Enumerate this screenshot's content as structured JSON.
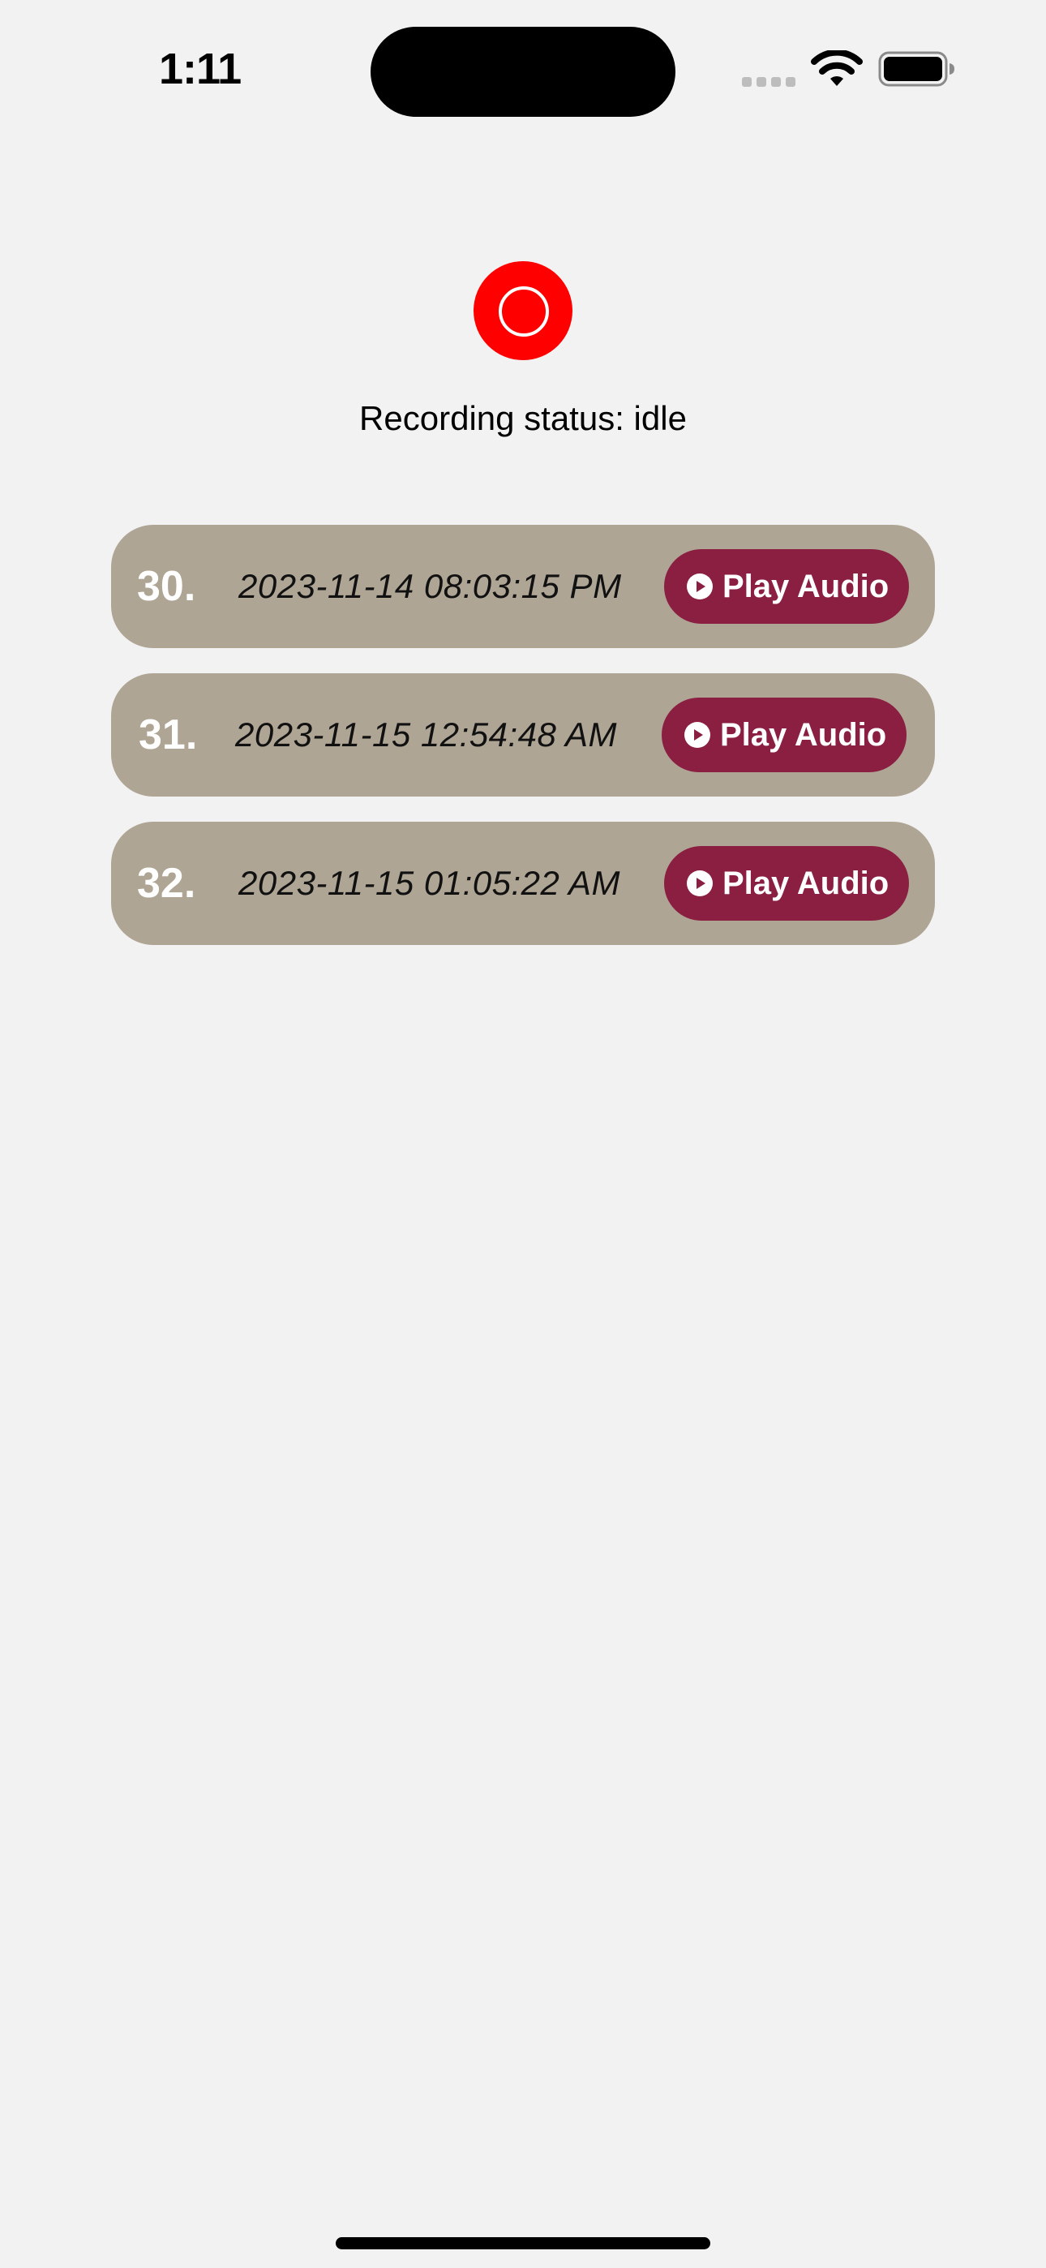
{
  "status_bar": {
    "time": "1:11"
  },
  "recorder": {
    "status_text": "Recording status: idle",
    "button_color": "#ff0000"
  },
  "recordings": [
    {
      "number": "30.",
      "date": "2023-11-14 08:03:15 PM",
      "play_label": "Play Audio"
    },
    {
      "number": "31.",
      "date": "2023-11-15 12:54:48 AM",
      "play_label": "Play Audio"
    },
    {
      "number": "32.",
      "date": "2023-11-15 01:05:22 AM",
      "play_label": "Play Audio"
    }
  ],
  "colors": {
    "background": "#f2f2f2",
    "row_background": "#afa595",
    "play_button": "#8a1f42",
    "record_button": "#ff0000"
  },
  "icons": {
    "record": "record-icon",
    "play": "play-circle-icon",
    "wifi": "wifi-icon",
    "battery": "battery-icon",
    "signal": "signal-icon"
  }
}
